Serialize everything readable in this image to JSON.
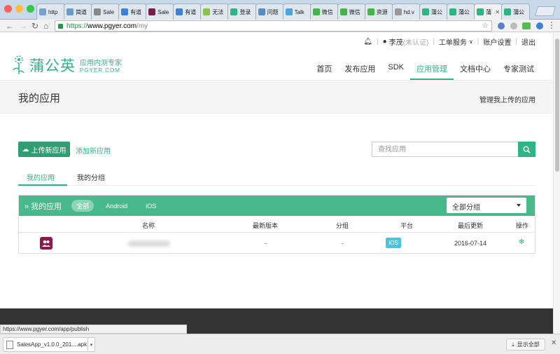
{
  "browser": {
    "tabs": [
      {
        "label": "http",
        "color": "#7aa0d0",
        "active": false
      },
      {
        "label": "简道",
        "color": "#6a9cc9",
        "active": false
      },
      {
        "label": "Sale",
        "color": "#888888",
        "active": false
      },
      {
        "label": "有道",
        "color": "#3b82d8",
        "active": false
      },
      {
        "label": "Sale",
        "color": "#7a1e45",
        "active": false
      },
      {
        "label": "有道",
        "color": "#3b82d8",
        "active": false
      },
      {
        "label": "无法",
        "color": "#8bc34a",
        "active": false
      },
      {
        "label": "登录",
        "color": "#2fb584",
        "active": false
      },
      {
        "label": "问题",
        "color": "#5a8ac6",
        "active": false
      },
      {
        "label": "Talk",
        "color": "#4aa3df",
        "active": false
      },
      {
        "label": "微信",
        "color": "#44b549",
        "active": false
      },
      {
        "label": "微信",
        "color": "#44b549",
        "active": false
      },
      {
        "label": "资源",
        "color": "#44b549",
        "active": false
      },
      {
        "label": "hd.v",
        "color": "#999999",
        "active": false
      },
      {
        "label": "蒲公",
        "color": "#2fb584",
        "active": false
      },
      {
        "label": "蒲公",
        "color": "#2fb584",
        "active": false
      },
      {
        "label": "蒲",
        "color": "#2fb584",
        "active": true
      },
      {
        "label": "蒲公",
        "color": "#2fb584",
        "active": false
      }
    ],
    "tab_close": "✕",
    "url": {
      "scheme": "https://",
      "host": "www.pgyer.com",
      "path": "/my"
    },
    "status_url": "https://www.pgyer.com/app/publish"
  },
  "topbar": {
    "user": "李茂",
    "verify": "(未认证)",
    "tickets": "工单服务",
    "account": "账户设置",
    "logout": "退出"
  },
  "logo": {
    "main": "蒲公英",
    "sub1": "应用内测专家",
    "sub2": "PGYER.COM"
  },
  "nav": [
    {
      "label": "首页",
      "active": false
    },
    {
      "label": "发布应用",
      "active": false
    },
    {
      "label": "SDK",
      "active": false
    },
    {
      "label": "应用管理",
      "active": true
    },
    {
      "label": "文档中心",
      "active": false
    },
    {
      "label": "专家测试",
      "active": false
    }
  ],
  "page": {
    "title": "我的应用",
    "manage_link": "管理我上传的应用"
  },
  "actions": {
    "upload": "上传新应用",
    "add": "添加新应用",
    "search_placeholder": "查找应用"
  },
  "subtabs": [
    {
      "label": "我的应用",
      "active": true
    },
    {
      "label": "我的分组",
      "active": false
    }
  ],
  "panel": {
    "title": "» 我的应用",
    "filters": [
      {
        "label": "全部",
        "active": true
      },
      {
        "label": "Android",
        "active": false
      },
      {
        "label": "iOS",
        "active": false
      }
    ],
    "group_select": "全部分组",
    "columns": {
      "name": "名称",
      "version": "最新版本",
      "group": "分组",
      "platform": "平台",
      "updated": "最后更新",
      "action": "操作"
    },
    "rows": [
      {
        "version": "-",
        "group": "-",
        "platform": "iOS",
        "updated": "2016-07-14"
      }
    ]
  },
  "downloads": {
    "file": "SalesApp_v1.0.0_201....apk",
    "show_all": "显示全部"
  }
}
